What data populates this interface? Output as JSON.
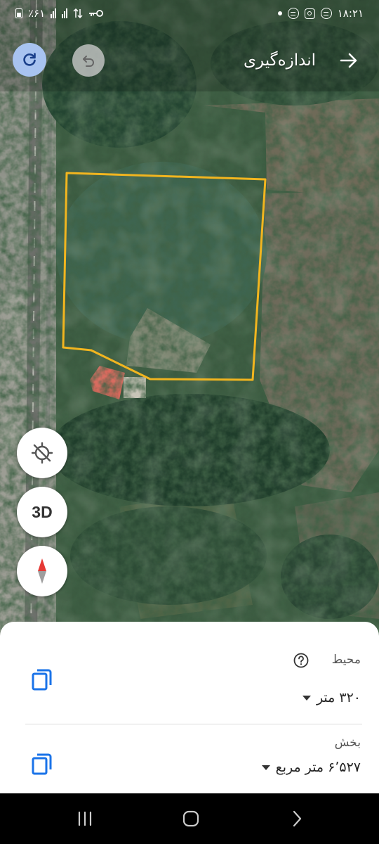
{
  "status_bar": {
    "time": "۱۸:۲۱",
    "battery": "٪۶۱",
    "icons": [
      "app-notification-icon",
      "instagram-icon",
      "app-notification-icon",
      "dot-icon",
      "battery-icon",
      "signal-icon",
      "signal-icon",
      "data-arrows-icon",
      "key-icon"
    ]
  },
  "header": {
    "title": "اندازه‌گیری",
    "back_icon": "arrow-right-icon",
    "refresh_icon": "refresh-icon",
    "undo_icon": "undo-icon"
  },
  "map": {
    "type": "satellite",
    "boundary_color": "#f2b51f"
  },
  "controls": {
    "location_icon": "location-disabled-icon",
    "view_3d_label": "3D",
    "compass_icon": "compass-icon"
  },
  "measurements": {
    "perimeter_label": "محیط",
    "perimeter_value": "۳۲۰ متر",
    "area_label": "بخش",
    "area_value": "۶٬۵۲۷ متر مربع",
    "copy_icon": "copy-icon",
    "help_icon": "help-icon"
  },
  "nav_bar": {
    "icons": [
      "recents-icon",
      "home-icon",
      "back-icon"
    ]
  },
  "colors": {
    "accent": "#1a73e8",
    "boundary": "#f2b51f",
    "refresh_bg": "#a8c3f0"
  }
}
